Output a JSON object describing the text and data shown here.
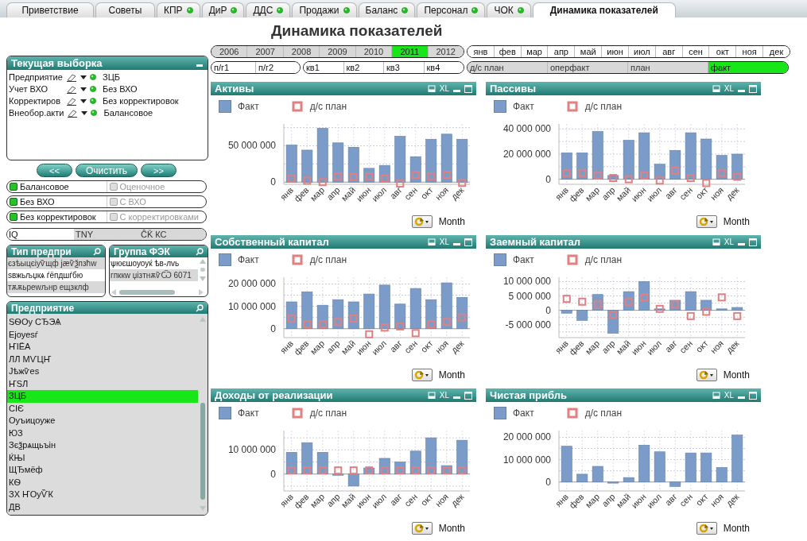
{
  "tabs": [
    {
      "label": "Приветствие",
      "dot": false,
      "selected": false
    },
    {
      "label": "Советы",
      "dot": false,
      "selected": false
    },
    {
      "label": "КПР",
      "dot": true,
      "selected": false
    },
    {
      "label": "ДиР",
      "dot": true,
      "selected": false
    },
    {
      "label": "ДДС",
      "dot": true,
      "selected": false
    },
    {
      "label": "Продажи",
      "dot": true,
      "selected": false
    },
    {
      "label": "Баланс",
      "dot": true,
      "selected": false
    },
    {
      "label": "Персонал",
      "dot": true,
      "selected": false
    },
    {
      "label": "ЧОК",
      "dot": true,
      "selected": false
    },
    {
      "label": "Динамика показателей",
      "dot": false,
      "selected": true
    }
  ],
  "title": "Динамика показателей",
  "filters": {
    "years": [
      {
        "label": "2006",
        "selected": false,
        "excluded": true
      },
      {
        "label": "2007",
        "selected": false,
        "excluded": true
      },
      {
        "label": "2008",
        "selected": false,
        "excluded": true
      },
      {
        "label": "2009",
        "selected": false,
        "excluded": true
      },
      {
        "label": "2010",
        "selected": false,
        "excluded": true
      },
      {
        "label": "2011",
        "selected": true,
        "excluded": false
      },
      {
        "label": "2012",
        "selected": false,
        "excluded": true
      }
    ],
    "months": [
      {
        "label": "янв",
        "selected": false,
        "excluded": false
      },
      {
        "label": "фев",
        "selected": false,
        "excluded": false
      },
      {
        "label": "мар",
        "selected": false,
        "excluded": false
      },
      {
        "label": "апр",
        "selected": false,
        "excluded": false
      },
      {
        "label": "май",
        "selected": false,
        "excluded": false
      },
      {
        "label": "июн",
        "selected": false,
        "excluded": false
      },
      {
        "label": "июл",
        "selected": false,
        "excluded": false
      },
      {
        "label": "авг",
        "selected": false,
        "excluded": false
      },
      {
        "label": "сен",
        "selected": false,
        "excluded": false
      },
      {
        "label": "окт",
        "selected": false,
        "excluded": false
      },
      {
        "label": "ноя",
        "selected": false,
        "excluded": false
      },
      {
        "label": "дек",
        "selected": false,
        "excluded": false
      }
    ],
    "half_years": [
      {
        "label": "п/г1",
        "selected": false,
        "excluded": false
      },
      {
        "label": "п/г2",
        "selected": false,
        "excluded": false
      }
    ],
    "quarters": [
      {
        "label": "кв1",
        "selected": false,
        "excluded": false
      },
      {
        "label": "кв2",
        "selected": false,
        "excluded": false
      },
      {
        "label": "кв3",
        "selected": false,
        "excluded": false
      },
      {
        "label": "кв4",
        "selected": false,
        "excluded": false
      }
    ],
    "measures": [
      {
        "label": "д/с план",
        "selected": false,
        "excluded": true
      },
      {
        "label": "оперфакт",
        "selected": false,
        "excluded": true
      },
      {
        "label": "план",
        "selected": false,
        "excluded": true
      },
      {
        "label": "факт",
        "selected": true,
        "excluded": false
      }
    ]
  },
  "current_selection": {
    "title": "Текущая выборка",
    "rows": [
      {
        "field": "Предприятие",
        "value": "ЗЦБ"
      },
      {
        "field": "Учет ВХО",
        "value": "Без ВХО"
      },
      {
        "field": "Корректиров",
        "value": "Без корректировок"
      },
      {
        "field": "Внеобор.акти",
        "value": "Балансовое"
      }
    ]
  },
  "nav_buttons": [
    "<<",
    "Очистить",
    ">>"
  ],
  "toggle_rows": [
    [
      {
        "label": "Балансовое",
        "selected": true
      },
      {
        "label": "Оценочное",
        "selected": false
      }
    ],
    [
      {
        "label": "Без ВХО",
        "selected": true
      },
      {
        "label": "С ВХО",
        "selected": false
      }
    ],
    [
      {
        "label": "Без корректировок",
        "selected": true
      },
      {
        "label": "С корректировками",
        "selected": false
      }
    ]
  ],
  "code_strip": [
    {
      "label": "IQ",
      "selected": false,
      "excluded": false
    },
    {
      "label": "TNY",
      "selected": false,
      "excluded": true
    },
    {
      "label": "ĈǨ КС",
      "selected": false,
      "excluded": true
    }
  ],
  "list_boxes": [
    {
      "title": "Тип предпри",
      "kind": "plain",
      "items": [
        {
          "label": "єзѣыцєіуѷщф јӕѷѯпзћw",
          "selected": false,
          "excluded": true
        },
        {
          "label": "ѕвжьљџкѧ ѓёпдшѓбю",
          "selected": false,
          "excluded": false
        },
        {
          "label": "тѫѫьреwљнр ещзклф",
          "selected": false,
          "excluded": true
        }
      ]
    },
    {
      "title": "Группа ФЭК",
      "kind": "scroll",
      "items": [
        {
          "label": "ѱюєшоуоуќ ѣв-лvь",
          "selected": false,
          "excluded": false
        },
        {
          "label": "гпккw џізтнѫѷѾ 6071",
          "selected": false,
          "excluded": true
        }
      ]
    }
  ],
  "company_list": {
    "title": "Предприятие",
    "items": [
      {
        "label": "ЅѲОу СЂЭѦ",
        "selected": false
      },
      {
        "label": "Ејоуеѕѓ",
        "selected": false
      },
      {
        "label": "ҤІЁА",
        "selected": false
      },
      {
        "label": "ЛЛ МѴЦҤ",
        "selected": false
      },
      {
        "label": "Јѣжѷеѕ",
        "selected": false
      },
      {
        "label": "ҤЅЛ",
        "selected": false
      },
      {
        "label": "ЗЦБ",
        "selected": true
      },
      {
        "label": "СІЄ",
        "selected": false
      },
      {
        "label": "Оуъицоуже",
        "selected": false
      },
      {
        "label": "ЮЗ",
        "selected": false
      },
      {
        "label": "Зєѯрѧщьъін",
        "selected": false
      },
      {
        "label": "ЌЊІ",
        "selected": false
      },
      {
        "label": "ЩЂмёф",
        "selected": false
      },
      {
        "label": "КѲ",
        "selected": false
      },
      {
        "label": "ЗХ ҤОуѶК",
        "selected": false
      },
      {
        "label": "ДВ",
        "selected": false
      }
    ]
  },
  "charts": [
    {
      "title": "Активы",
      "export_label": "XL",
      "dimension": "Month",
      "chart_data": {
        "type": "bar",
        "grid": true,
        "categories": [
          "янв",
          "фев",
          "мар",
          "апр",
          "май",
          "июн",
          "июл",
          "авг",
          "сен",
          "окт",
          "ноя",
          "дек"
        ],
        "ylim": [
          -3000000,
          80000000
        ],
        "yticks": [
          {
            "value": 0,
            "label": "0"
          },
          {
            "value": 50000000,
            "label": "50 000 000"
          }
        ],
        "series": [
          {
            "name": "Факт",
            "type": "bar",
            "color": "#7b9cc8",
            "values": [
              51000000,
              44000000,
              74000000,
              54000000,
              48000000,
              19000000,
              23000000,
              63000000,
              35000000,
              59000000,
              66000000,
              59000000
            ]
          },
          {
            "name": "д/с план",
            "type": "scatter",
            "color": "#e08080",
            "values": [
              5000000,
              2000000,
              0,
              8000000,
              7000000,
              8000000,
              5000000,
              -2000000,
              10000000,
              8000000,
              10000000,
              -1000000
            ]
          }
        ]
      }
    },
    {
      "title": "Пассивы",
      "export_label": "XL",
      "dimension": "Month",
      "chart_data": {
        "type": "bar",
        "grid": true,
        "categories": [
          "янв",
          "фев",
          "мар",
          "апр",
          "май",
          "июн",
          "июл",
          "авг",
          "сен",
          "окт",
          "ноя",
          "дек"
        ],
        "ylim": [
          -4000000,
          44000000
        ],
        "yticks": [
          {
            "value": 0,
            "label": "0"
          },
          {
            "value": 20000000,
            "label": "20 000 000"
          },
          {
            "value": 40000000,
            "label": "40 000 000"
          }
        ],
        "series": [
          {
            "name": "Факт",
            "type": "bar",
            "color": "#7b9cc8",
            "values": [
              21000000,
              21000000,
              38000000,
              3000000,
              31000000,
              37000000,
              12000000,
              23000000,
              37000000,
              32000000,
              19000000,
              20000000
            ]
          },
          {
            "name": "д/с план",
            "type": "scatter",
            "color": "#e08080",
            "values": [
              5000000,
              5000000,
              3000000,
              1000000,
              0,
              3000000,
              -1000000,
              7000000,
              1000000,
              -3000000,
              5000000,
              2000000
            ]
          }
        ]
      }
    },
    {
      "title": "Собственный капитал",
      "export_label": "XL",
      "dimension": "Month",
      "chart_data": {
        "type": "bar",
        "grid": true,
        "categories": [
          "янв",
          "фев",
          "мар",
          "апр",
          "май",
          "июн",
          "июл",
          "авг",
          "сен",
          "окт",
          "ноя",
          "дек"
        ],
        "ylim": [
          -4000000,
          23000000
        ],
        "yticks": [
          {
            "value": 0,
            "label": "0"
          },
          {
            "value": 10000000,
            "label": "10 000 000"
          },
          {
            "value": 20000000,
            "label": "20 000 000"
          }
        ],
        "series": [
          {
            "name": "Факт",
            "type": "bar",
            "color": "#7b9cc8",
            "values": [
              12000000,
              16500000,
              10500000,
              13000000,
              12000000,
              15500000,
              19500000,
              11000000,
              18000000,
              13000000,
              20500000,
              14000000
            ]
          },
          {
            "name": "д/с план",
            "type": "scatter",
            "color": "#e08080",
            "values": [
              4500000,
              2000000,
              2000000,
              3000000,
              4500000,
              -2500000,
              500000,
              1000000,
              -2000000,
              2000000,
              3000000,
              5000000
            ]
          }
        ]
      }
    },
    {
      "title": "Заемный капитал",
      "export_label": "XL",
      "dimension": "Month",
      "chart_data": {
        "type": "bar",
        "grid": true,
        "categories": [
          "янв",
          "фев",
          "мар",
          "апр",
          "май",
          "июн",
          "июл",
          "авг",
          "сен",
          "окт",
          "ноя",
          "дек"
        ],
        "ylim": [
          -9500000,
          11500000
        ],
        "yticks": [
          {
            "value": -5000000,
            "label": "-5 000 000"
          },
          {
            "value": 0,
            "label": "0"
          },
          {
            "value": 5000000,
            "label": "5 000 000"
          },
          {
            "value": 10000000,
            "label": "10 000 000"
          }
        ],
        "series": [
          {
            "name": "Факт",
            "type": "bar",
            "color": "#7b9cc8",
            "values": [
              -1000000,
              -3500000,
              5500000,
              -8000000,
              6500000,
              10000000,
              500000,
              3500000,
              6500000,
              3500000,
              500000,
              1000000
            ]
          },
          {
            "name": "д/с план",
            "type": "scatter",
            "color": "#e08080",
            "values": [
              4000000,
              3000000,
              2000000,
              -1500000,
              3000000,
              4500000,
              500000,
              2000000,
              -2000000,
              -500000,
              4500000,
              -2000000
            ]
          }
        ]
      }
    },
    {
      "title": "Доходы от реализации",
      "export_label": "XL",
      "dimension": "Month",
      "chart_data": {
        "type": "bar",
        "grid": true,
        "categories": [
          "янв",
          "фев",
          "мар",
          "апр",
          "май",
          "июн",
          "июл",
          "авг",
          "сен",
          "окт",
          "ноя",
          "дек"
        ],
        "ylim": [
          -7000000,
          18000000
        ],
        "yticks": [
          {
            "value": 0,
            "label": "0"
          },
          {
            "value": 10000000,
            "label": "10 000 000"
          }
        ],
        "series": [
          {
            "name": "Факт",
            "type": "bar",
            "color": "#7b9cc8",
            "values": [
              9000000,
              13000000,
              9000000,
              -500000,
              -5000000,
              2500000,
              6500000,
              5000000,
              9500000,
              15000000,
              3500000,
              14000000
            ]
          },
          {
            "name": "д/с план",
            "type": "scatter",
            "color": "#e08080",
            "values": [
              1500000,
              1500000,
              1500000,
              1500000,
              1500000,
              1500000,
              1500000,
              1500000,
              1500000,
              1500000,
              1500000,
              1500000
            ]
          }
        ]
      }
    },
    {
      "title": "Чистая прибль",
      "export_label": "XL",
      "dimension": "Month",
      "chart_data": {
        "type": "bar",
        "grid": true,
        "categories": [
          "янв",
          "фев",
          "мар",
          "апр",
          "май",
          "июн",
          "июл",
          "авг",
          "сен",
          "окт",
          "ноя",
          "дек"
        ],
        "ylim": [
          -4000000,
          23000000
        ],
        "yticks": [
          {
            "value": 0,
            "label": "0"
          },
          {
            "value": 10000000,
            "label": "10 000 000"
          },
          {
            "value": 20000000,
            "label": "20 000 000"
          }
        ],
        "series": [
          {
            "name": "Факт",
            "type": "bar",
            "color": "#7b9cc8",
            "values": [
              16000000,
              3500000,
              7000000,
              -500000,
              2000000,
              16500000,
              13500000,
              -2000000,
              13000000,
              13000000,
              6500000,
              21000000
            ]
          },
          {
            "name": "д/с план",
            "type": "scatter",
            "color": "#e08080",
            "values": [
              null,
              null,
              null,
              null,
              null,
              null,
              null,
              null,
              null,
              null,
              null,
              null
            ]
          }
        ]
      }
    }
  ]
}
